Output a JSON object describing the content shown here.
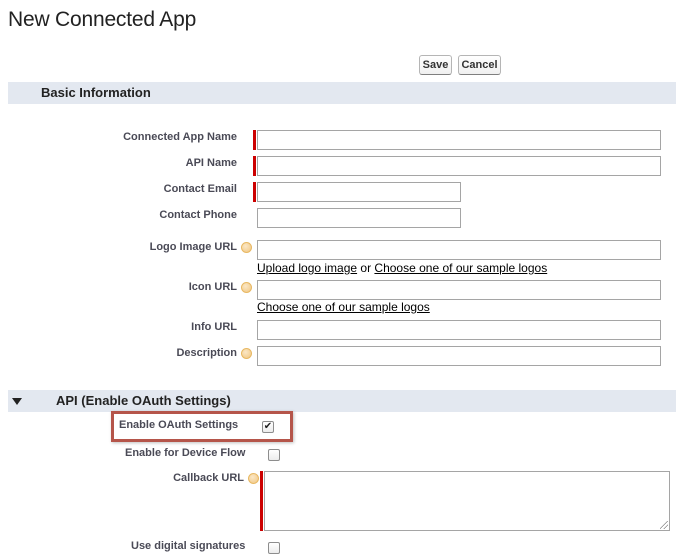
{
  "page": {
    "title": "New Connected App"
  },
  "toolbar": {
    "save_label": "Save",
    "cancel_label": "Cancel"
  },
  "sections": {
    "basic": {
      "title": "Basic Information"
    },
    "api": {
      "title": "API (Enable OAuth Settings)"
    }
  },
  "fields": {
    "app_name": {
      "label": "Connected App Name",
      "value": "",
      "required": true
    },
    "api_name": {
      "label": "API Name",
      "value": "",
      "required": true
    },
    "contact_email": {
      "label": "Contact Email",
      "value": "",
      "required": true
    },
    "contact_phone": {
      "label": "Contact Phone",
      "value": ""
    },
    "logo_url": {
      "label": "Logo Image URL",
      "value": ""
    },
    "icon_url": {
      "label": "Icon URL",
      "value": ""
    },
    "info_url": {
      "label": "Info URL",
      "value": ""
    },
    "description": {
      "label": "Description",
      "value": ""
    },
    "enable_oauth": {
      "label": "Enable OAuth Settings",
      "checked": true
    },
    "device_flow": {
      "label": "Enable for Device Flow",
      "checked": false
    },
    "callback_url": {
      "label": "Callback URL",
      "value": "",
      "required": true
    },
    "digital_signatures": {
      "label": "Use digital signatures",
      "checked": false
    }
  },
  "links": {
    "upload_logo": "Upload logo image",
    "or_text": " or ",
    "choose_logo": "Choose one of our sample logos",
    "choose_icon": "Choose one of our sample logos"
  },
  "colors": {
    "section_bg": "#e3e8f0",
    "required": "#cc0000",
    "highlight": "#b5554a"
  }
}
